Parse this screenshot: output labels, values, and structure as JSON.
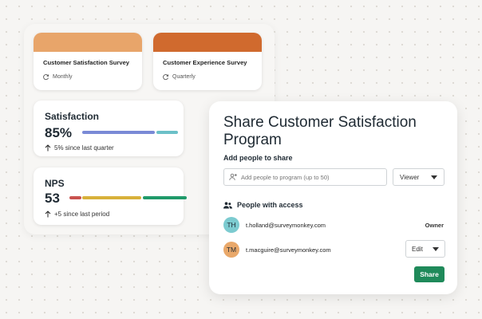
{
  "colors": {
    "survey1_bar": "#e8a56a",
    "survey2_bar": "#d06a2e",
    "satisfaction_progress": "#7a8ad6",
    "satisfaction_remainder": "#6cc0c8",
    "nps_detractors": "#c9524e",
    "nps_passives": "#d8b13a",
    "nps_promoters": "#1f9a6a",
    "share_button": "#1f8a5a",
    "avatar_th": "#7ccbd0",
    "avatar_tm": "#e9a86a"
  },
  "surveys": [
    {
      "title": "Customer Satisfaction Survey",
      "frequency": "Monthly",
      "icon": "refresh-icon"
    },
    {
      "title": "Customer Experience Survey",
      "frequency": "Quarterly",
      "icon": "refresh-icon"
    }
  ],
  "satisfaction": {
    "title": "Satisfaction",
    "value": "85%",
    "percent": 0.85,
    "change": "5% since last quarter",
    "icon": "arrow-up-icon"
  },
  "nps": {
    "title": "NPS",
    "value": "53",
    "change": "+5 since last period",
    "icon": "arrow-up-icon",
    "distribution": {
      "detractors": 0.11,
      "passives": 0.52,
      "promoters": 0.37
    }
  },
  "share": {
    "title": "Share Customer Satisfaction Program",
    "add_label": "Add people to share",
    "add_placeholder": "Add people to program (up to 50)",
    "permission": "Viewer",
    "access_label": "People with access",
    "users": [
      {
        "initials": "TH",
        "email": "t.holland@surveymonkey.com",
        "role": "Owner"
      },
      {
        "initials": "TM",
        "email": "t.macguire@surveymonkey.com",
        "role": "Edit"
      }
    ],
    "share_button": "Share"
  }
}
